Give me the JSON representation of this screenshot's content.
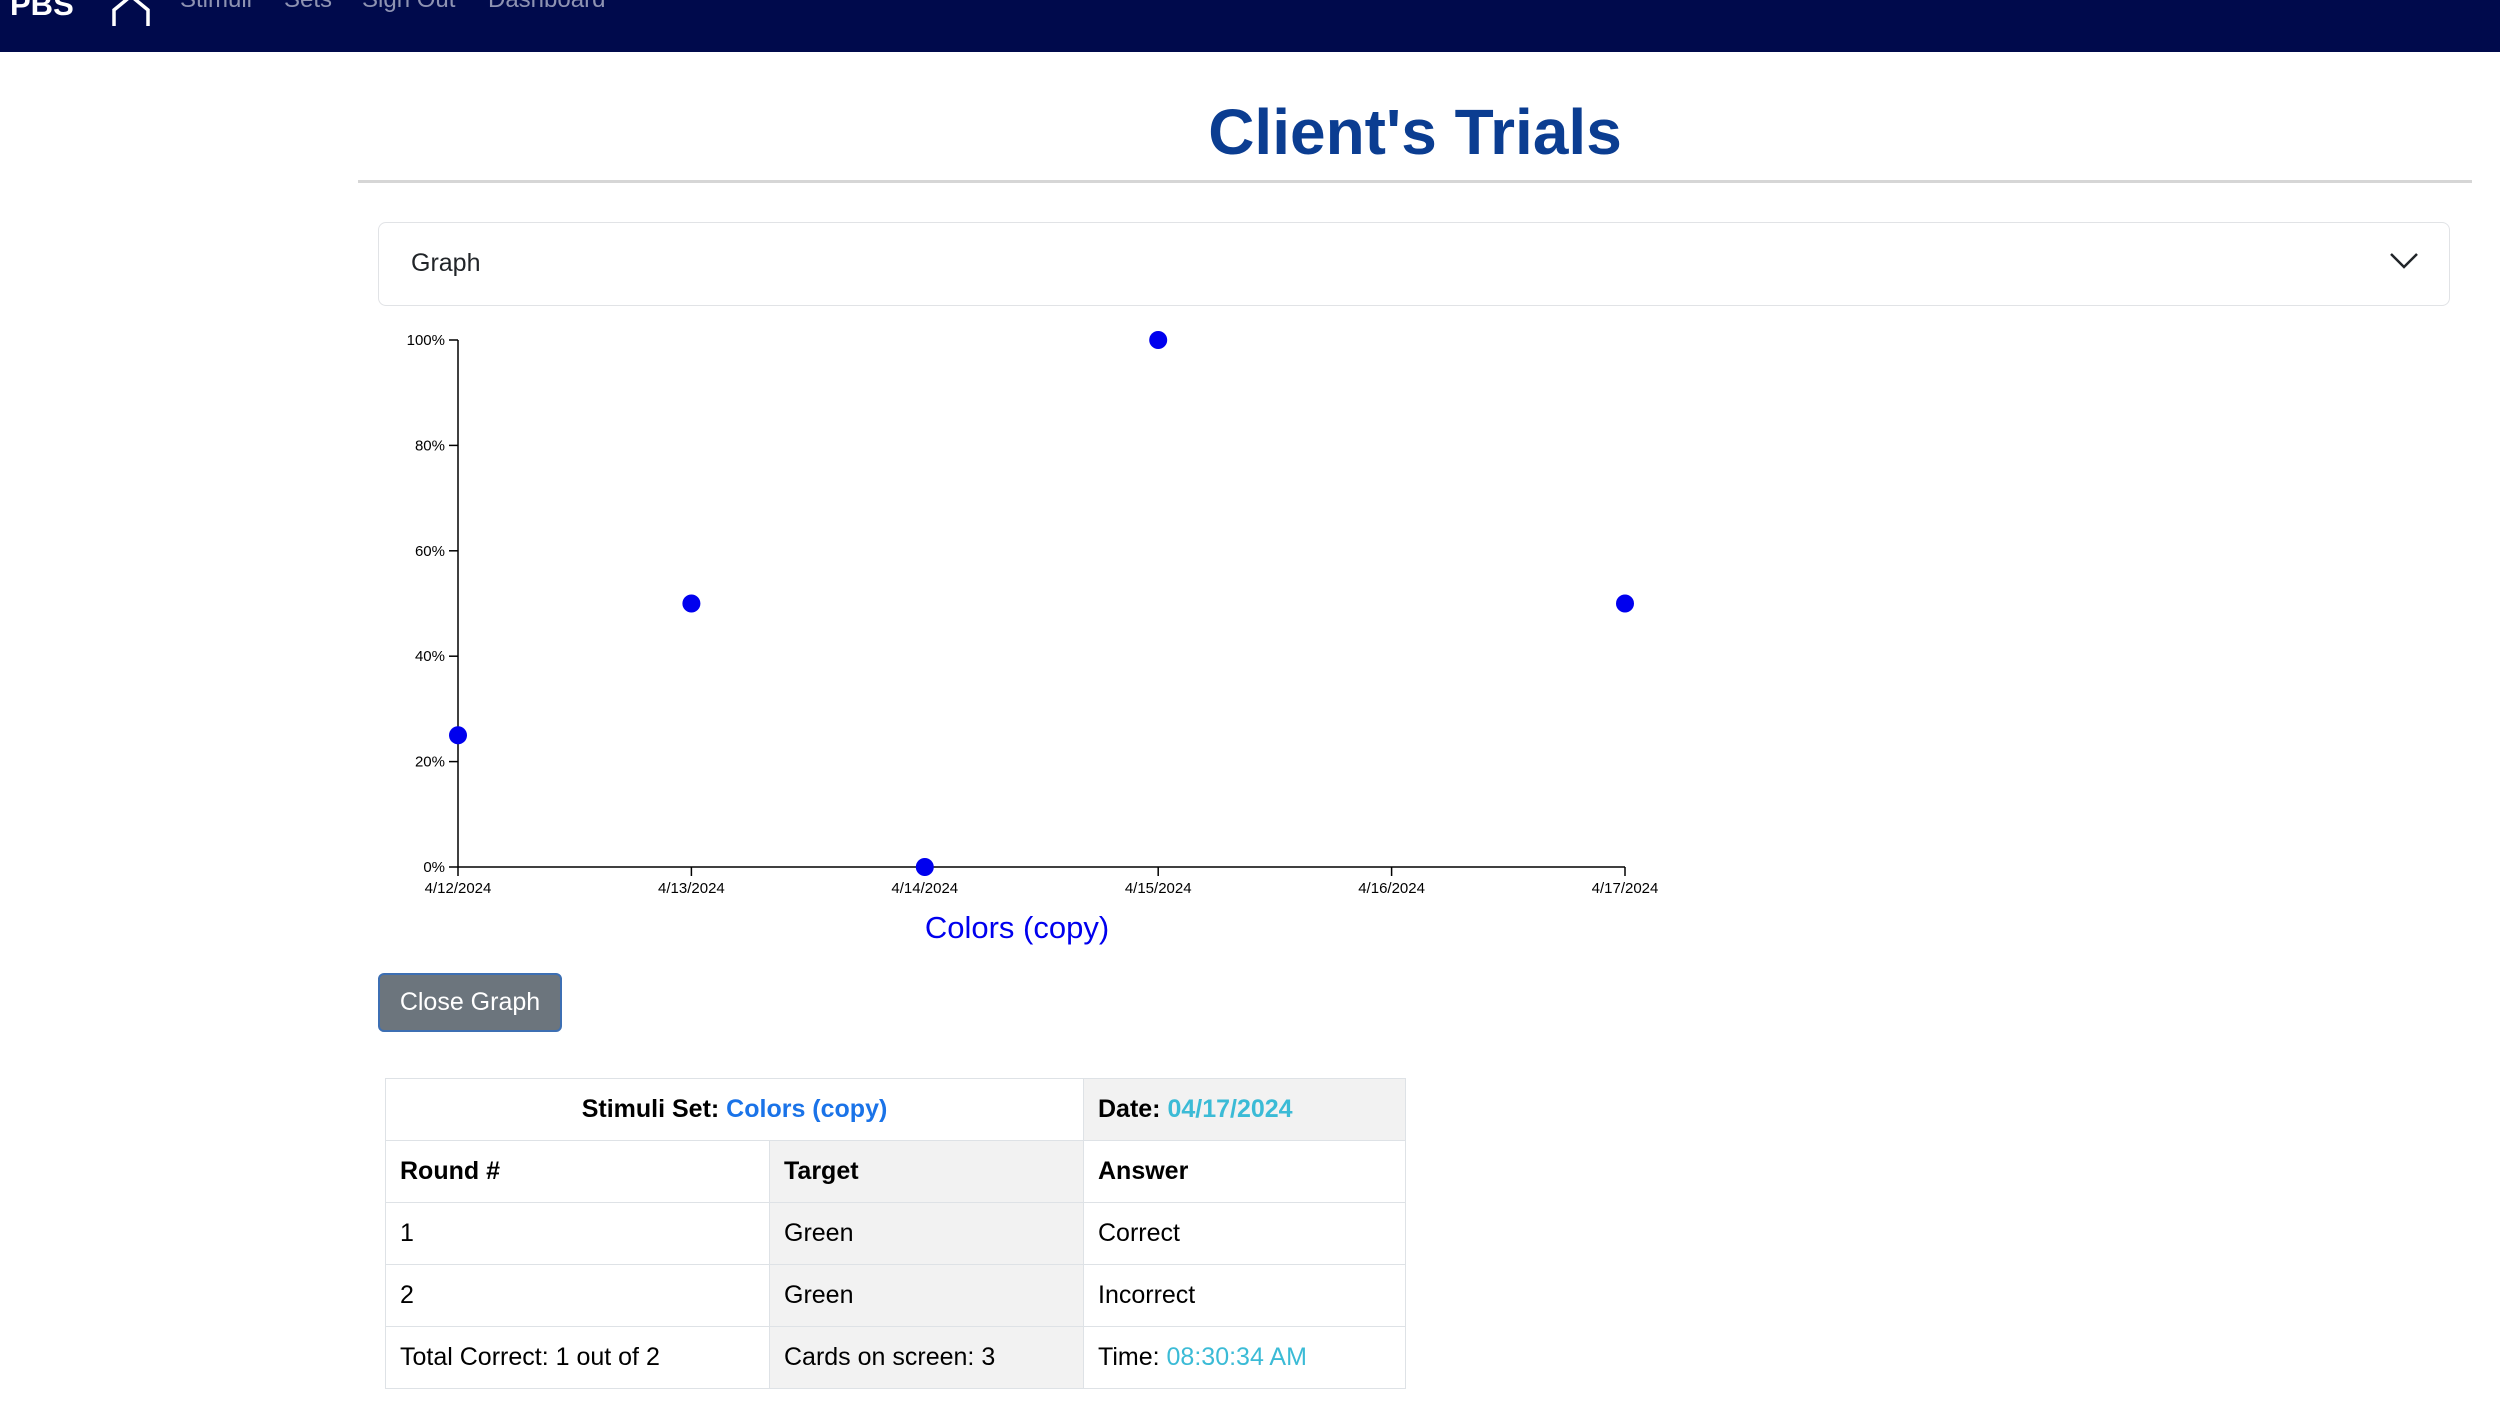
{
  "navbar": {
    "brand": "PBS",
    "links": [
      "Stimuli",
      "Sets",
      "Sign Out",
      "Dashboard"
    ],
    "home_icon": "home-icon",
    "background": "#000a4c"
  },
  "page": {
    "title": "Client's Trials",
    "title_color": "#0b3d91"
  },
  "accordion": {
    "label": "Graph",
    "icon": "chevron-down-icon"
  },
  "chart_data": {
    "type": "scatter",
    "title": "Colors (copy)",
    "x_tick_labels": [
      "4/12/2024",
      "4/13/2024",
      "4/14/2024",
      "4/15/2024",
      "4/16/2024",
      "4/17/2024"
    ],
    "y_tick_labels": [
      "0%",
      "20%",
      "40%",
      "60%",
      "80%",
      "100%"
    ],
    "ylim": [
      0,
      100
    ],
    "xlim": [
      "4/12/2024",
      "4/17/2024"
    ],
    "grid": false,
    "point_color": "#0000ee",
    "points": [
      {
        "x": "4/12/2024",
        "y": 25
      },
      {
        "x": "4/13/2024",
        "y": 50
      },
      {
        "x": "4/14/2024",
        "y": 0
      },
      {
        "x": "4/15/2024",
        "y": 100
      },
      {
        "x": "4/17/2024",
        "y": 50
      }
    ]
  },
  "button": {
    "close_label": "Close Graph"
  },
  "table": {
    "stimuli_label": "Stimuli Set:",
    "stimuli_value": "Colors (copy)",
    "date_label": "Date:",
    "date_value": "04/17/2024",
    "headers": [
      "Round #",
      "Target",
      "Answer"
    ],
    "rows": [
      [
        "1",
        "Green",
        "Correct"
      ],
      [
        "2",
        "Green",
        "Incorrect"
      ]
    ],
    "footer": {
      "total": "Total Correct: 1 out of 2",
      "cards": "Cards on screen: 3",
      "time_label": "Time:",
      "time_value": "08:30:34 AM"
    }
  }
}
